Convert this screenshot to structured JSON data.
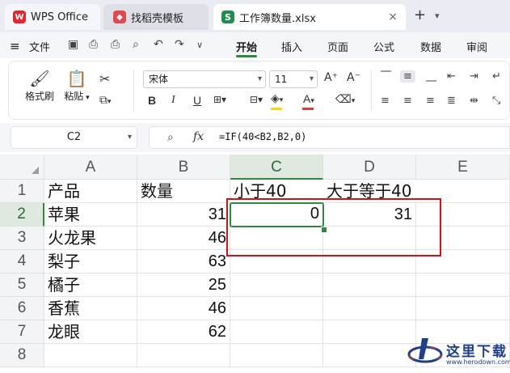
{
  "tabs": {
    "wps": "WPS Office",
    "template": "找稻壳模板",
    "file": "工作簿数量.xlsx",
    "file_icon": "S",
    "close": "×",
    "add": "+",
    "add_chevron": "⌄"
  },
  "menu": {
    "file": "文件",
    "tabs": [
      "开始",
      "插入",
      "页面",
      "公式",
      "数据",
      "审阅"
    ],
    "active_tab": "开始"
  },
  "ribbon": {
    "format_painter": "格式刷",
    "paste": "粘贴",
    "font_name": "宋体",
    "font_size": "11",
    "bold": "B",
    "italic": "I",
    "underline": "U",
    "grow": "A⁺",
    "shrink": "A⁻",
    "fill_color": "#f5d90a",
    "font_color": "#e53935"
  },
  "formula_bar": {
    "name_box": "C2",
    "fx": "fx",
    "formula": "=IF(40<B2,B2,0)"
  },
  "grid": {
    "columns": [
      "A",
      "B",
      "C",
      "D",
      "E"
    ],
    "active_column": "C",
    "rows": [
      "1",
      "2",
      "3",
      "4",
      "5",
      "6",
      "7",
      "8"
    ],
    "active_row": "2",
    "cells": {
      "A1": "产品",
      "B1": "数量",
      "C1": "小于40",
      "D1": "大于等于40",
      "A2": "苹果",
      "B2": "31",
      "C2": "0",
      "D2": "31",
      "A3": "火龙果",
      "B3": "46",
      "A4": "梨子",
      "B4": "63",
      "A5": "橘子",
      "B5": "25",
      "A6": "香蕉",
      "B6": "46",
      "A7": "龙眼",
      "B7": "62"
    },
    "selected_cell": "C2",
    "accent": "#2f8a40",
    "highlight_color": "#d0121b"
  },
  "watermark": {
    "text": "这里下载",
    "url": "www.herodown.com"
  }
}
